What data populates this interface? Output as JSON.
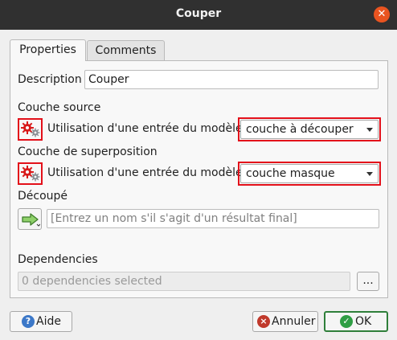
{
  "window": {
    "title": "Couper"
  },
  "tabs": [
    {
      "label": "Properties",
      "active": true
    },
    {
      "label": "Comments",
      "active": false
    }
  ],
  "description": {
    "label": "Description",
    "value": "Couper"
  },
  "source_layer": {
    "label": "Couche source",
    "input_label": "Utilisation d'une entrée du modèle",
    "selected": "couche à découper"
  },
  "overlay_layer": {
    "label": "Couche de superposition",
    "input_label": "Utilisation d'une entrée du modèle",
    "selected": "couche masque"
  },
  "output": {
    "label": "Découpé",
    "placeholder": "[Entrez un nom s'il s'agit d'un résultat final]"
  },
  "dependencies": {
    "label": "Dependencies",
    "value": "0 dependencies selected",
    "browse_label": "..."
  },
  "buttons": {
    "help": "Aide",
    "cancel": "Annuler",
    "ok": "OK"
  },
  "icons": {
    "model_input": "model-input-gears-icon",
    "output_arrow": "output-arrow-icon",
    "help": "help-icon",
    "cancel": "cancel-icon",
    "ok": "ok-icon"
  },
  "colors": {
    "titlebar": "#303030",
    "close": "#e95420",
    "highlight": "#e3101a",
    "ok_border": "#2f7f3a"
  }
}
